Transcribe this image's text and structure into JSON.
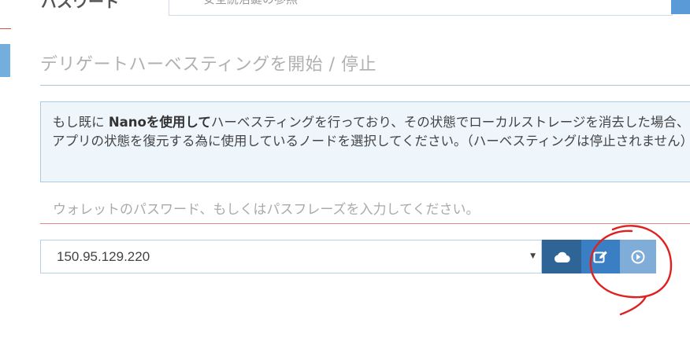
{
  "top_row": {
    "label": "パスワード",
    "input_placeholder": "安全統治鍵の参照"
  },
  "section": {
    "heading": "デリゲートハーベスティングを開始 / 停止"
  },
  "info": {
    "text_before": "もし既に ",
    "text_bold": "Nanoを使用して",
    "text_after": "ハーベスティングを行っており、その状態でローカルストレージを消去した場合、アプリの状態を復元する為に使用しているノードを選択してください。（ハーベスティングは停止されません）"
  },
  "password": {
    "placeholder": "ウォレットのパスワード、もしくはパスフレーズを入力してください。"
  },
  "node": {
    "selected": "150.95.129.220"
  },
  "buttons": {
    "cloud_icon": "cloud-icon",
    "edit_icon": "edit-icon",
    "play_icon": "play-circle-icon"
  },
  "colors": {
    "cloud_button": "#2e6496",
    "edit_button": "#3a7fc4",
    "play_button": "#7fadd8",
    "annotation": "#e02020"
  }
}
